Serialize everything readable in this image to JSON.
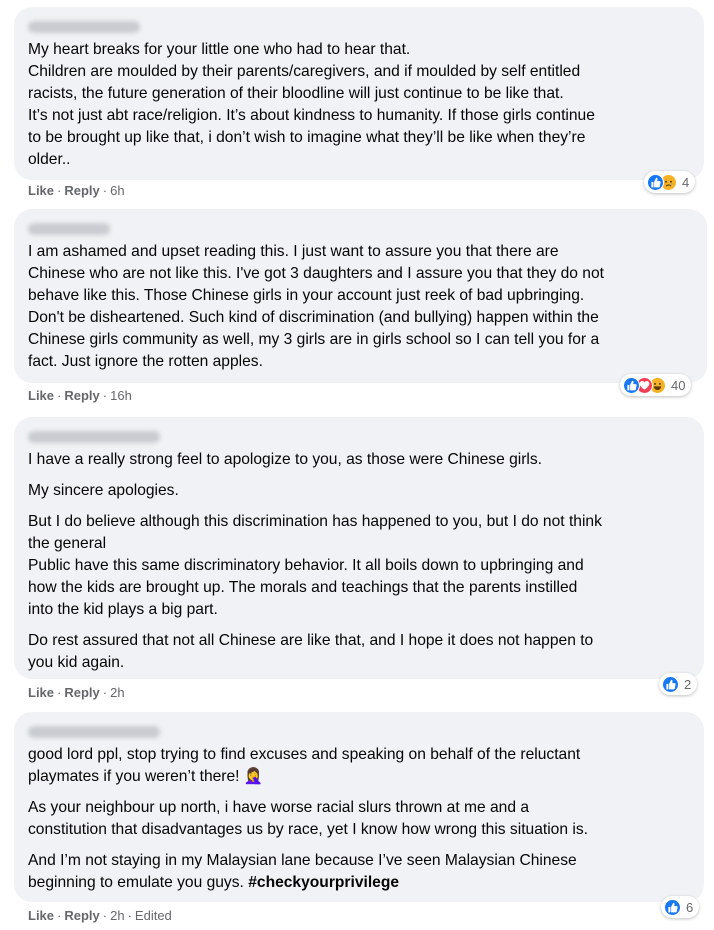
{
  "comments": [
    {
      "paragraphs": [
        [
          "My heart breaks for your little one who had to hear that.",
          "Children are moulded by their parents/caregivers, and if moulded by self entitled",
          "racists, the future generation of their bloodline will just continue to be like that.",
          "It’s not just abt race/religion. It’s about kindness to humanity. If those girls continue",
          "to be brought up like that, i don’t wish to imagine what they’ll be like when they’re",
          "older.."
        ]
      ],
      "like": "Like",
      "reply": "Reply",
      "time": "6h",
      "edited": "",
      "reactions": [
        "like-icon",
        "sad-icon"
      ],
      "reaction_count": "4"
    },
    {
      "paragraphs": [
        [
          "I am ashamed and upset reading this. I just want to assure you that there are",
          "Chinese who are not like this. I've got 3 daughters and I assure you that they do not",
          "behave like this. Those Chinese girls in your account just reek of bad upbringing.",
          "Don't be disheartened. Such kind of discrimination (and bullying) happen within the",
          "Chinese girls community as well, my 3 girls are in girls school so I can tell you for a",
          "fact. Just ignore the rotten apples."
        ]
      ],
      "like": "Like",
      "reply": "Reply",
      "time": "16h",
      "edited": "",
      "reactions": [
        "like-icon",
        "love-icon",
        "haha-icon"
      ],
      "reaction_count": "40"
    },
    {
      "paragraphs": [
        [
          "I have a really strong feel to apologize to you, as those were Chinese girls."
        ],
        [
          "My sincere apologies."
        ],
        [
          "But I do believe although this discrimination has happened to you, but I do not think",
          "the general",
          "Public have this same discriminatory behavior. It all boils down to upbringing and",
          "how the kids are brought up. The morals and teachings that the parents instilled",
          "into the kid plays a big part."
        ],
        [
          "Do rest assured that not all Chinese are like that, and I hope it does not happen to",
          "you kid again."
        ]
      ],
      "like": "Like",
      "reply": "Reply",
      "time": "2h",
      "edited": "",
      "reactions": [
        "like-icon"
      ],
      "reaction_count": "2"
    },
    {
      "paragraphs": [
        [
          "good lord ppl, stop trying to find excuses and speaking on behalf of the reluctant",
          "playmates if you weren’t there! 🤦‍♀️"
        ],
        [
          "As your neighbour up north, i have worse racial slurs thrown at me and a",
          "constitution that disadvantages us by race, yet I know how wrong this situation is."
        ],
        [
          "And I’m not staying in my Malaysian lane because I’ve seen Malaysian Chinese",
          "beginning to emulate you guys."
        ]
      ],
      "hashtag": "#checkyourprivilege",
      "like": "Like",
      "reply": "Reply",
      "time": "2h",
      "edited": "Edited",
      "reactions": [
        "like-icon"
      ],
      "reaction_count": "6"
    }
  ],
  "colors": {
    "bubble": "#f0f2f5",
    "meta": "#65676b",
    "like": "#1877f2",
    "love": "#f33e58",
    "haha": "#f7b125"
  }
}
